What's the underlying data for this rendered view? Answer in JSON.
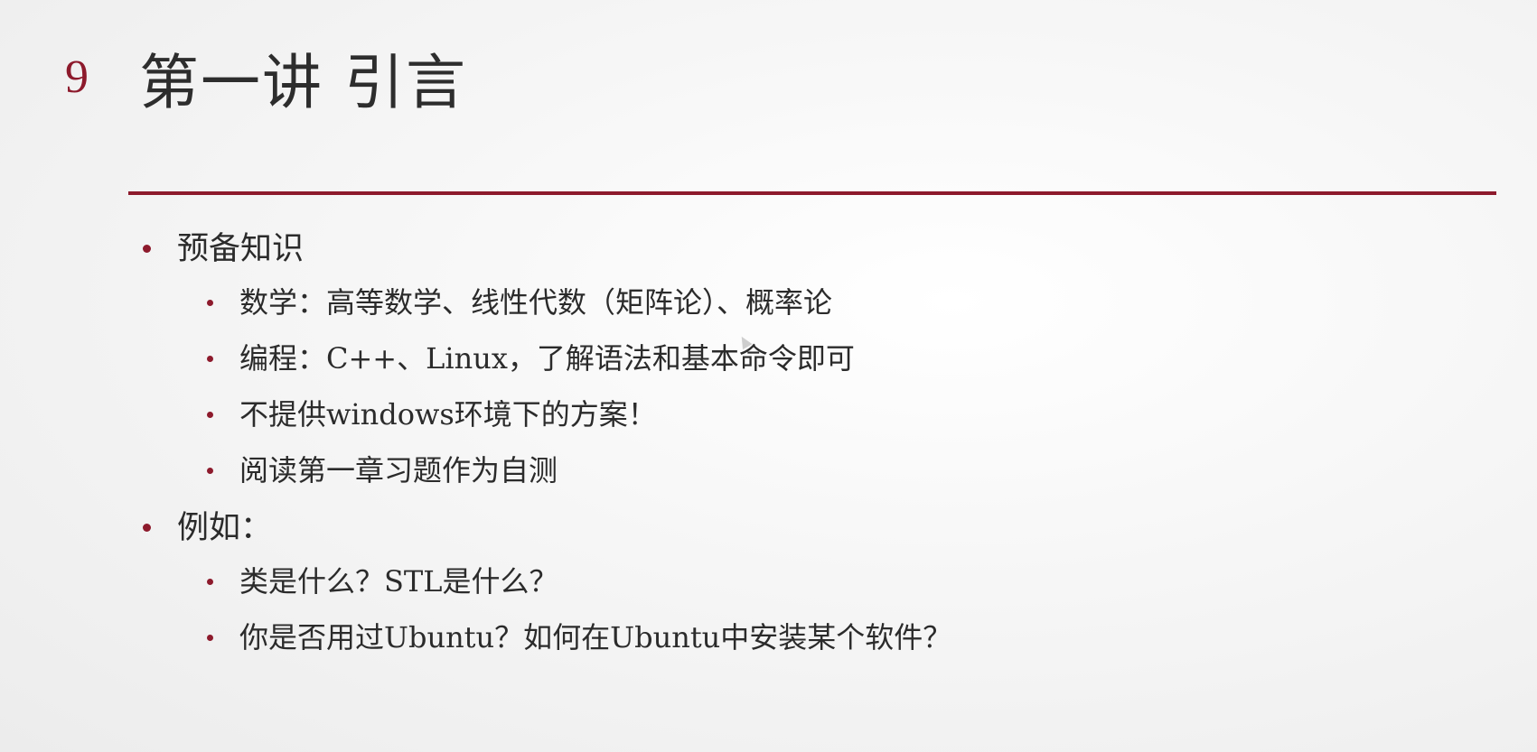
{
  "slide": {
    "number": "9",
    "title": "第一讲 引言",
    "accent_color": "#8d1a2c"
  },
  "sections": [
    {
      "label": "预备知识",
      "items": [
        "数学：高等数学、线性代数（矩阵论）、概率论",
        "编程：C++、Linux，了解语法和基本命令即可",
        "不提供windows环境下的方案！",
        "阅读第一章习题作为自测"
      ]
    },
    {
      "label": "例如：",
      "items": [
        "类是什么？STL是什么？",
        "你是否用过Ubuntu？如何在Ubuntu中安装某个软件？"
      ]
    }
  ]
}
